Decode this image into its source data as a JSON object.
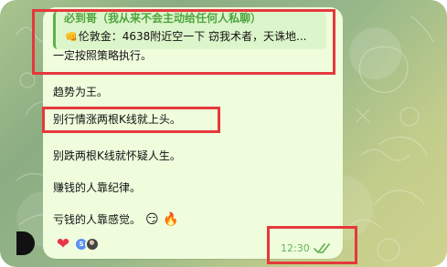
{
  "message": {
    "reply_title": "必到哥（我从来不会主动给任何人私聊）",
    "reply_text": "伦敦金：4638附近空一下 窃我术者，天诛地...",
    "reply_icon": "👊",
    "lines": [
      "一定按照策略执行。",
      "趋势为王。",
      "别行情涨两根K线就上头。",
      "别跌两根K线就怀疑人生。",
      "赚钱的人靠纪律。",
      "亏钱的人靠感觉。"
    ],
    "line6_emojis": "😏 🔥",
    "time": "12:30",
    "reactions": {
      "heart": "❤",
      "avatar_1_text": "S"
    }
  },
  "colors": {
    "bubble": "#effddd",
    "accent_green": "#5cb24f",
    "annotation_red": "#e5383b",
    "heart_red": "#ea3346"
  },
  "icons": {
    "reply": "fist-bump-icon",
    "reaction": "heart-icon",
    "status": "double-check-icon"
  }
}
